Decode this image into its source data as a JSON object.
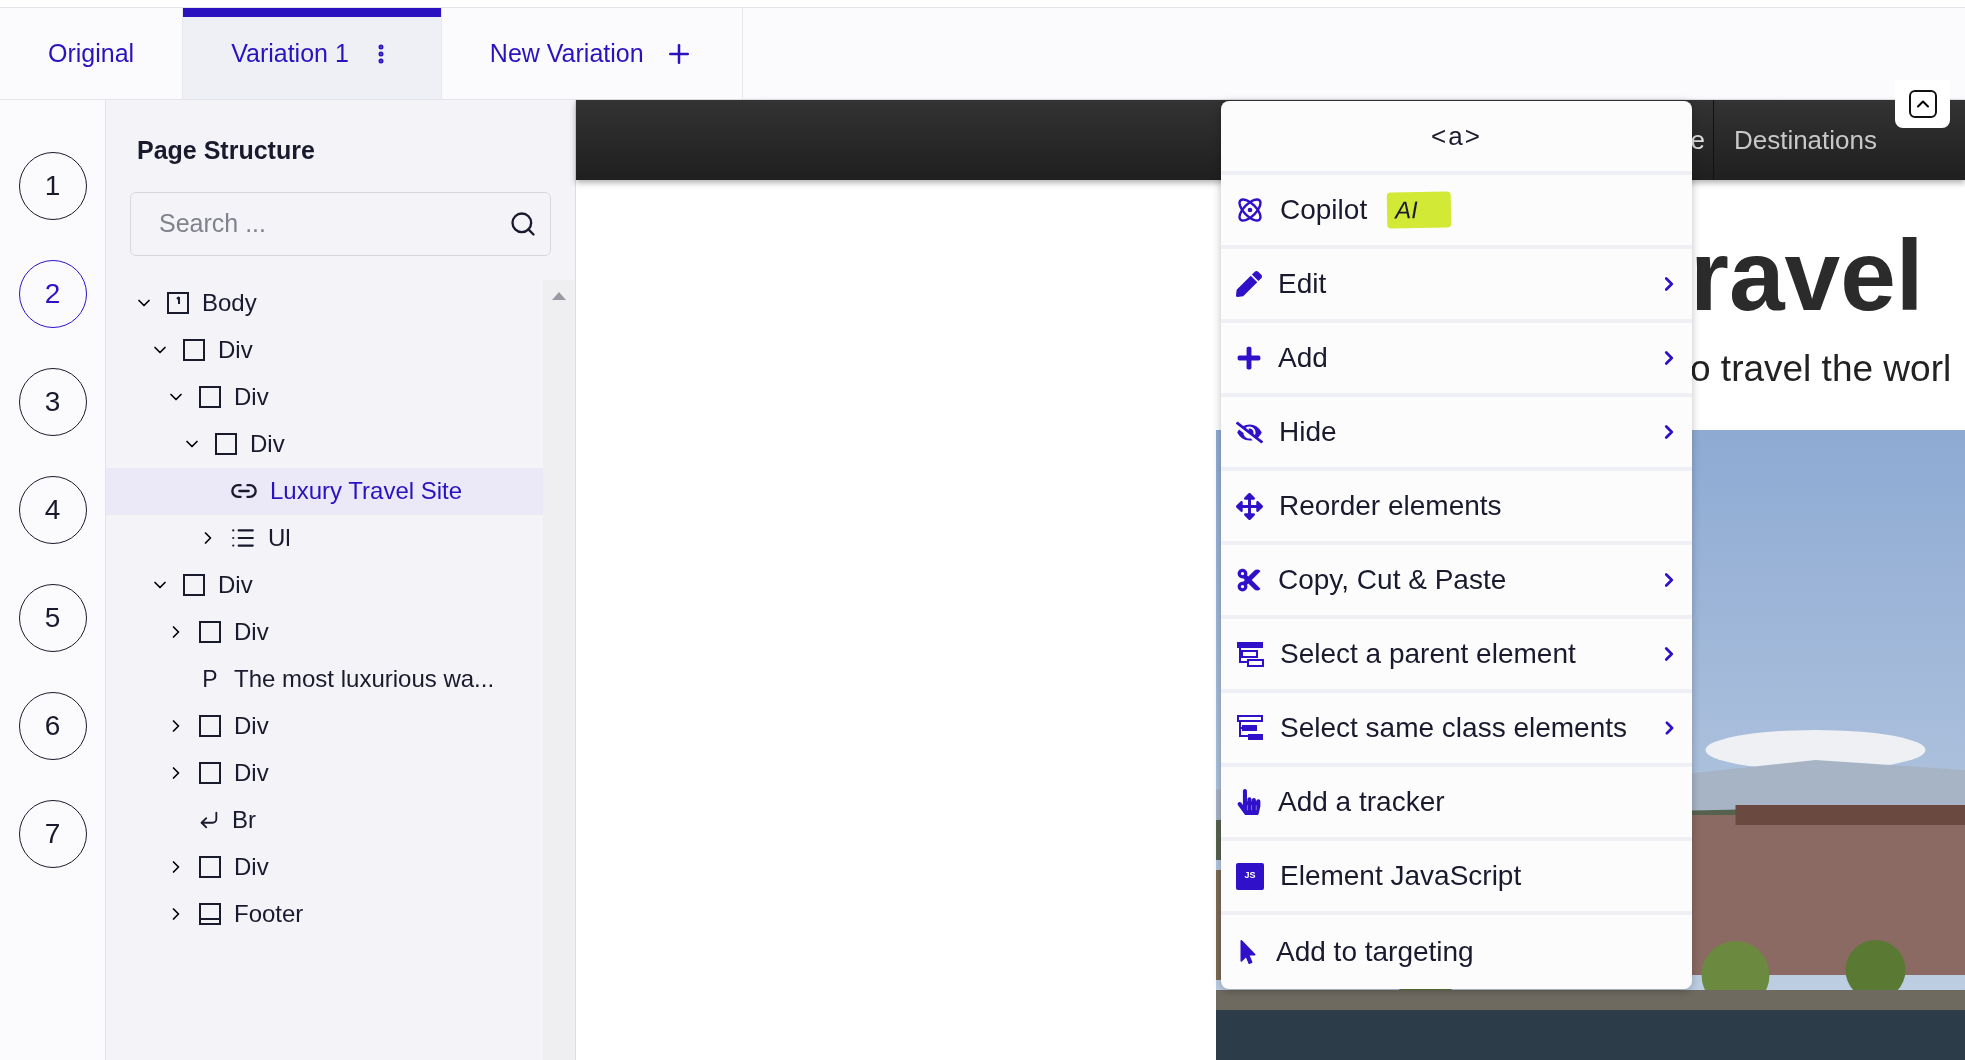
{
  "tabs": [
    {
      "label": "Original",
      "kind": "plain",
      "selected": false
    },
    {
      "label": "Variation 1",
      "kind": "options",
      "selected": true
    },
    {
      "label": "New Variation",
      "kind": "add",
      "selected": false
    }
  ],
  "steps": [
    {
      "label": "1",
      "selected": false
    },
    {
      "label": "2",
      "selected": true
    },
    {
      "label": "3",
      "selected": false
    },
    {
      "label": "4",
      "selected": false
    },
    {
      "label": "5",
      "selected": false
    },
    {
      "label": "6",
      "selected": false
    },
    {
      "label": "7",
      "selected": false
    }
  ],
  "page_structure": {
    "title": "Page Structure",
    "search": {
      "placeholder": "Search ..."
    },
    "tree": [
      {
        "label": "Body",
        "kind": "body",
        "expanded": true,
        "selected": false,
        "children": [
          {
            "label": "Div",
            "kind": "div",
            "expanded": true,
            "selected": false,
            "children": [
              {
                "label": "Div",
                "kind": "div",
                "expanded": true,
                "selected": false,
                "children": [
                  {
                    "label": "Div",
                    "kind": "div",
                    "expanded": true,
                    "selected": false,
                    "children": [
                      {
                        "label": "Luxury Travel Site",
                        "kind": "link",
                        "selected": true
                      },
                      {
                        "label": "Ul",
                        "kind": "list",
                        "expanded": false,
                        "selected": false
                      }
                    ]
                  }
                ]
              }
            ]
          },
          {
            "label": "Div",
            "kind": "div",
            "expanded": true,
            "selected": false,
            "children": [
              {
                "label": "Div",
                "kind": "div",
                "expanded": false,
                "selected": false
              },
              {
                "label": "The most luxurious wa...",
                "kind": "paragraph",
                "icon_text": "P",
                "selected": false
              },
              {
                "label": "Div",
                "kind": "div",
                "expanded": false,
                "selected": false
              },
              {
                "label": "Div",
                "kind": "div",
                "expanded": false,
                "selected": false
              },
              {
                "label": "Br",
                "kind": "break",
                "selected": false
              },
              {
                "label": "Div",
                "kind": "div",
                "expanded": false,
                "selected": false
              },
              {
                "label": "Footer",
                "kind": "footer",
                "expanded": false,
                "selected": false
              }
            ]
          }
        ]
      }
    ]
  },
  "site": {
    "nav": [
      "e",
      "Destinations"
    ],
    "heading": "ravel",
    "subtitle": "o travel the worl"
  },
  "context_menu": {
    "title": "<a>",
    "items": [
      {
        "label": "Copilot",
        "kind": "copilot",
        "badge": "AI",
        "submenu": false
      },
      {
        "label": "Edit",
        "kind": "edit",
        "submenu": true
      },
      {
        "label": "Add",
        "kind": "add",
        "submenu": true
      },
      {
        "label": "Hide",
        "kind": "hide",
        "submenu": true
      },
      {
        "label": "Reorder elements",
        "kind": "reorder",
        "submenu": false
      },
      {
        "label": "Copy, Cut & Paste",
        "kind": "copy",
        "submenu": true
      },
      {
        "label": "Select a parent element",
        "kind": "parent",
        "submenu": true
      },
      {
        "label": "Select same class elements",
        "kind": "same-class",
        "submenu": true
      },
      {
        "label": "Add a tracker",
        "kind": "tracker",
        "submenu": false
      },
      {
        "label": "Element JavaScript",
        "kind": "javascript",
        "icon_text": "JS",
        "submenu": false
      },
      {
        "label": "Add to targeting",
        "kind": "targeting",
        "submenu": false
      }
    ]
  }
}
